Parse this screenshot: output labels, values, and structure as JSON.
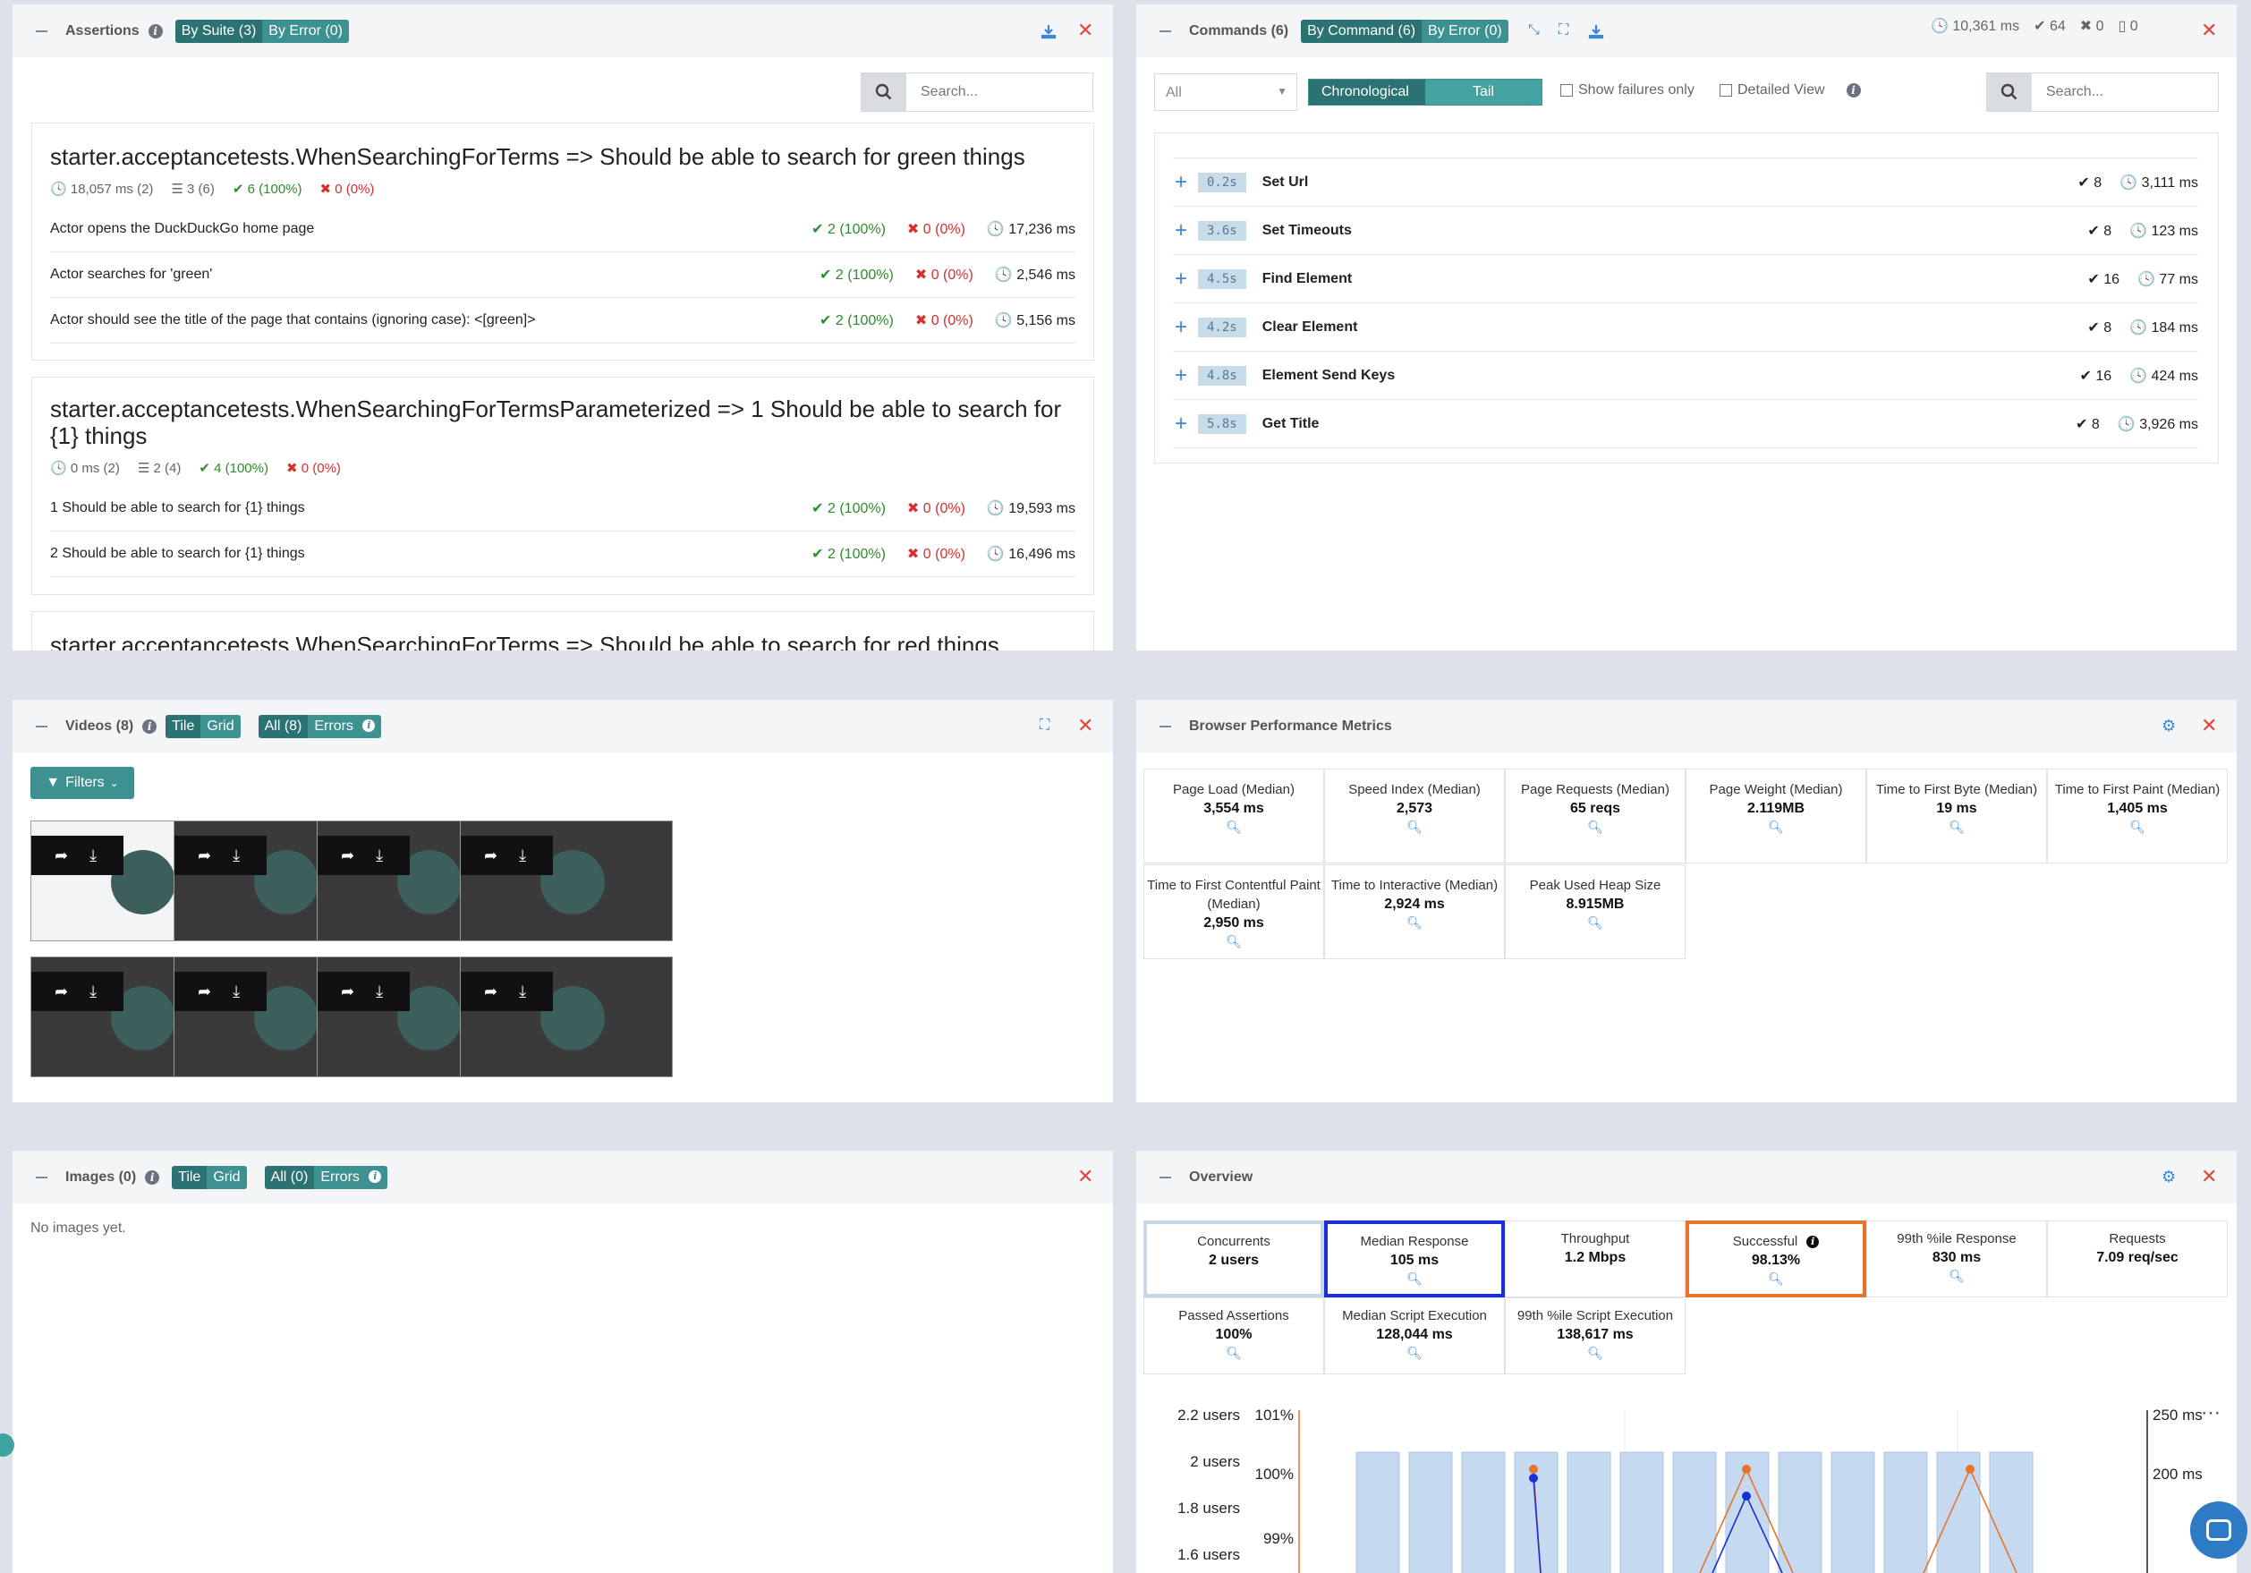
{
  "assertions": {
    "title": "Assertions",
    "toggle": [
      "By Suite (3)",
      "By Error (0)"
    ],
    "search_placeholder": "Search...",
    "suites": [
      {
        "title": "starter.acceptancetests.WhenSearchingForTerms => Should be able to search for green things",
        "meta": {
          "time": "18,057 ms (2)",
          "steps": "3 (6)",
          "pass": "6 (100%)",
          "fail": "0 (0%)"
        },
        "rows": [
          {
            "name": "Actor opens the DuckDuckGo home page",
            "pass": "2 (100%)",
            "fail": "0 (0%)",
            "time": "17,236 ms"
          },
          {
            "name": "Actor searches for 'green'",
            "pass": "2 (100%)",
            "fail": "0 (0%)",
            "time": "2,546 ms"
          },
          {
            "name": "Actor should see the title of the page that contains (ignoring case): <[green]>",
            "pass": "2 (100%)",
            "fail": "0 (0%)",
            "time": "5,156 ms"
          }
        ]
      },
      {
        "title": "starter.acceptancetests.WhenSearchingForTermsParameterized => 1 Should be able to search for {1} things",
        "meta": {
          "time": "0 ms (2)",
          "steps": "2 (4)",
          "pass": "4 (100%)",
          "fail": "0 (0%)"
        },
        "rows": [
          {
            "name": "1 Should be able to search for {1} things",
            "pass": "2 (100%)",
            "fail": "0 (0%)",
            "time": "19,593 ms"
          },
          {
            "name": "2 Should be able to search for {1} things",
            "pass": "2 (100%)",
            "fail": "0 (0%)",
            "time": "16,496 ms"
          }
        ]
      },
      {
        "title": "starter.acceptancetests.WhenSearchingForTerms => Should be able to search for red things"
      }
    ]
  },
  "commands": {
    "title": "Commands (6)",
    "toggle": [
      "By Command (6)",
      "By Error (0)"
    ],
    "stats": {
      "time": "10,361 ms",
      "pass": "64",
      "fail": "0",
      "files": "0"
    },
    "select": "All",
    "view": [
      "Chronological",
      "Tail"
    ],
    "show_failures": "Show failures only",
    "detailed": "Detailed View",
    "search_placeholder": "Search...",
    "rows": [
      {
        "tag": "0.2s",
        "name": "Set Url",
        "count": "8",
        "time": "3,111 ms"
      },
      {
        "tag": "3.6s",
        "name": "Set Timeouts",
        "count": "8",
        "time": "123 ms"
      },
      {
        "tag": "4.5s",
        "name": "Find Element",
        "count": "16",
        "time": "77 ms"
      },
      {
        "tag": "4.2s",
        "name": "Clear Element",
        "count": "8",
        "time": "184 ms"
      },
      {
        "tag": "4.8s",
        "name": "Element Send Keys",
        "count": "16",
        "time": "424 ms"
      },
      {
        "tag": "5.8s",
        "name": "Get Title",
        "count": "8",
        "time": "3,926 ms"
      }
    ]
  },
  "videos": {
    "title": "Videos (8)",
    "view": [
      "Tile",
      "Grid"
    ],
    "filter": [
      "All (8)",
      "Errors"
    ],
    "filters_button": "Filters"
  },
  "browser_metrics": {
    "title": "Browser Performance Metrics",
    "items": [
      {
        "label": "Page Load (Median)",
        "value": "3,554 ms"
      },
      {
        "label": "Speed Index (Median)",
        "value": "2,573"
      },
      {
        "label": "Page Requests (Median)",
        "value": "65 reqs"
      },
      {
        "label": "Page Weight (Median)",
        "value": "2.119MB"
      },
      {
        "label": "Time to First Byte (Median)",
        "value": "19 ms"
      },
      {
        "label": "Time to First Paint (Median)",
        "value": "1,405 ms"
      },
      {
        "label": "Time to First Contentful Paint (Median)",
        "value": "2,950 ms"
      },
      {
        "label": "Time to Interactive (Median)",
        "value": "2,924 ms"
      },
      {
        "label": "Peak Used Heap Size",
        "value": "8.915MB"
      }
    ]
  },
  "images": {
    "title": "Images (0)",
    "view": [
      "Tile",
      "Grid"
    ],
    "filter": [
      "All (0)",
      "Errors"
    ],
    "empty": "No images yet."
  },
  "overview": {
    "title": "Overview",
    "items": [
      {
        "label": "Concurrents",
        "value": "2 users"
      },
      {
        "label": "Median Response",
        "value": "105 ms"
      },
      {
        "label": "Throughput",
        "value": "1.2 Mbps"
      },
      {
        "label": "Successful",
        "value": "98.13%"
      },
      {
        "label": "99th %ile Response",
        "value": "830 ms"
      },
      {
        "label": "Requests",
        "value": "7.09 req/sec"
      },
      {
        "label": "Passed Assertions",
        "value": "100%"
      },
      {
        "label": "Median Script Execution",
        "value": "128,044 ms"
      },
      {
        "label": "99th %ile Script Execution",
        "value": "138,617 ms"
      }
    ],
    "colors": {
      "median_response": "#1a2fd6",
      "successful": "#e8742c",
      "bars": "#c5daf1"
    },
    "chart": {
      "users_ticks": [
        "2.2 users",
        "2 users",
        "1.8 users",
        "1.6 users"
      ],
      "pct_ticks": [
        "101%",
        "100%",
        "99%"
      ],
      "ms_ticks": [
        "250 ms",
        "200 ms"
      ]
    }
  }
}
